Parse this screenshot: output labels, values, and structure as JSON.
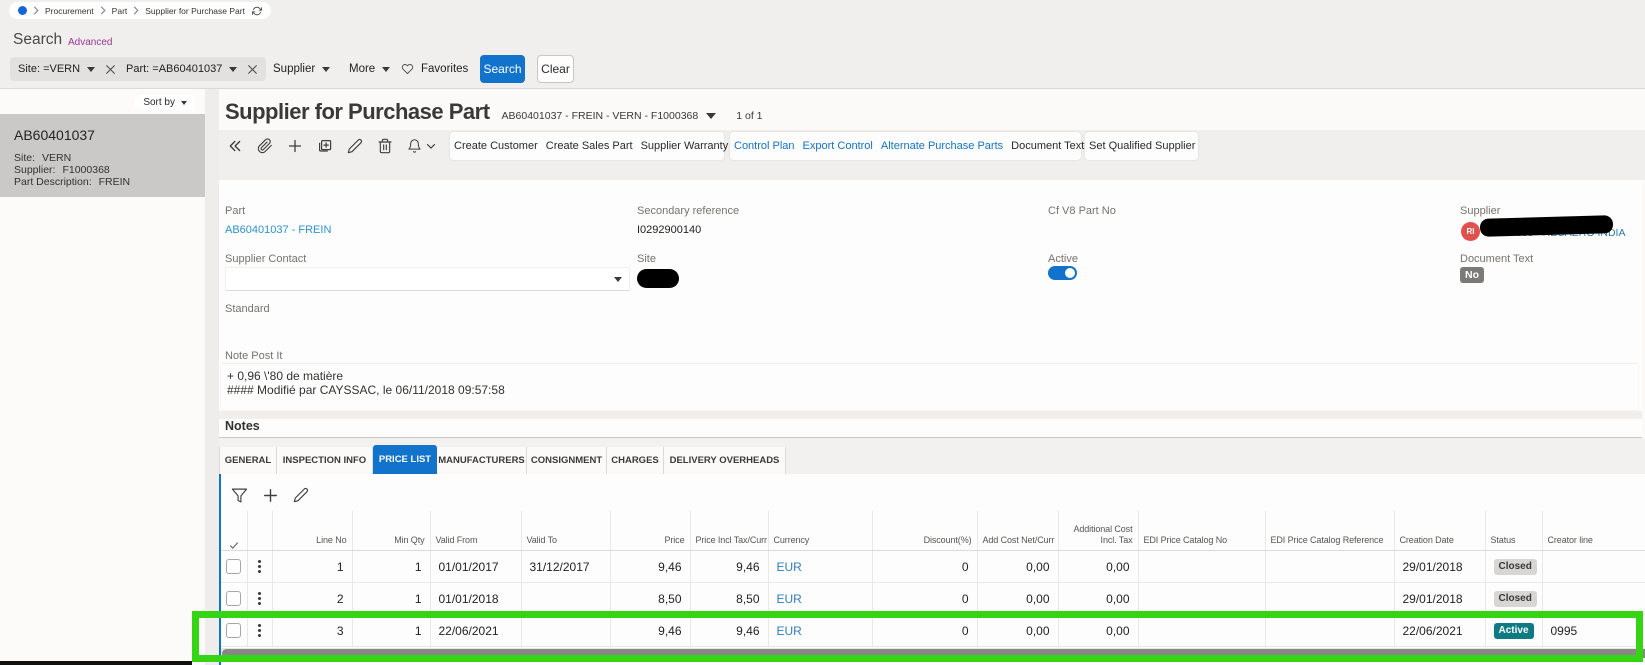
{
  "breadcrumb": {
    "items": [
      "Procurement",
      "Part",
      "Supplier for Purchase Part"
    ]
  },
  "search": {
    "title": "Search",
    "advanced_label": "Advanced",
    "chips": [
      {
        "label": "Site: =VERN"
      },
      {
        "label": "Part: =AB60401037"
      }
    ],
    "dropdowns": [
      {
        "label": "Supplier"
      },
      {
        "label": "More"
      }
    ],
    "favorites_label": "Favorites",
    "search_button": "Search",
    "clear_button": "Clear"
  },
  "sidebar": {
    "sort_by_label": "Sort by",
    "card": {
      "id": "AB60401037",
      "fields": [
        {
          "label": "Site:",
          "value": "VERN"
        },
        {
          "label": "Supplier:",
          "value": "F1000368"
        },
        {
          "label": "Part Description:",
          "value": "FREIN"
        }
      ]
    }
  },
  "header": {
    "title": "Supplier for Purchase Part",
    "record": "AB60401037 - FREIN - VERN - F1000368",
    "count": "1 of 1"
  },
  "toolbar": {
    "groups": [
      [
        {
          "label": "Create Customer",
          "blue": false
        },
        {
          "label": "Create Sales Part",
          "blue": false
        },
        {
          "label": "Supplier Warranty",
          "blue": false
        }
      ],
      [
        {
          "label": "Control Plan",
          "blue": true
        },
        {
          "label": "Export Control",
          "blue": true
        },
        {
          "label": "Alternate Purchase Parts",
          "blue": true
        },
        {
          "label": "Document Text",
          "blue": false
        }
      ],
      [
        {
          "label": "Set Qualified Supplier",
          "blue": false
        }
      ]
    ]
  },
  "form": {
    "part": {
      "label": "Part",
      "value": "AB60401037 - FREIN"
    },
    "secondary_reference": {
      "label": "Secondary reference",
      "value": "I0292900140"
    },
    "cf_v8_part_no": {
      "label": "Cf V8 Part No",
      "value": ""
    },
    "supplier": {
      "label": "Supplier",
      "avatar": "RI",
      "value": "F1000368 - RECAERO INDIA"
    },
    "supplier_contact": {
      "label": "Supplier Contact",
      "value": ""
    },
    "site": {
      "label": "Site",
      "value": ""
    },
    "active": {
      "label": "Active",
      "state": "on"
    },
    "document_text": {
      "label": "Document Text",
      "value": "No"
    },
    "standard": {
      "label": "Standard",
      "value": ""
    },
    "note": {
      "label": "Note Post It",
      "lines": [
        "+ 0,96 \\'80 de matière",
        "#### Modifié par CAYSSAC, le 06/11/2018 09:57:58"
      ]
    }
  },
  "notes_section": {
    "title": "Notes"
  },
  "tabs": {
    "items": [
      "GENERAL",
      "INSPECTION INFO",
      "PRICE LIST",
      "MANUFACTURERS",
      "CONSIGNMENT",
      "CHARGES",
      "DELIVERY OVERHEADS"
    ],
    "active": "PRICE LIST"
  },
  "table": {
    "columns": [
      "",
      "",
      "Line No",
      "Min Qty",
      "Valid From",
      "Valid To",
      "Price",
      "Price Incl Tax/Curr",
      "Currency",
      "Discount(%)",
      "Add Cost Net/Curr",
      "Additional Cost Incl. Tax",
      "EDI Price Catalog No",
      "EDI Price Catalog Reference",
      "Creation Date",
      "Status",
      "Creator line"
    ],
    "rows": [
      {
        "line_no": "1",
        "min_qty": "1",
        "valid_from": "01/01/2017",
        "valid_to": "31/12/2017",
        "price": "9,46",
        "price_incl_tax": "9,46",
        "currency": "EUR",
        "discount": "0",
        "add_cost": "0,00",
        "additional_cost": "0,00",
        "edi_no": "",
        "edi_ref": "",
        "creation_date": "29/01/2018",
        "status": "Closed",
        "creator_line": ""
      },
      {
        "line_no": "2",
        "min_qty": "1",
        "valid_from": "01/01/2018",
        "valid_to": "",
        "price": "8,50",
        "price_incl_tax": "8,50",
        "currency": "EUR",
        "discount": "0",
        "add_cost": "0,00",
        "additional_cost": "0,00",
        "edi_no": "",
        "edi_ref": "",
        "creation_date": "29/01/2018",
        "status": "Closed",
        "creator_line": ""
      },
      {
        "line_no": "3",
        "min_qty": "1",
        "valid_from": "22/06/2021",
        "valid_to": "",
        "price": "9,46",
        "price_incl_tax": "9,46",
        "currency": "EUR",
        "discount": "0",
        "add_cost": "0,00",
        "additional_cost": "0,00",
        "edi_no": "",
        "edi_ref": "",
        "creation_date": "22/06/2021",
        "status": "Active",
        "creator_line": "0995"
      }
    ]
  },
  "annotation": {
    "highlight_color": "#35d414"
  }
}
